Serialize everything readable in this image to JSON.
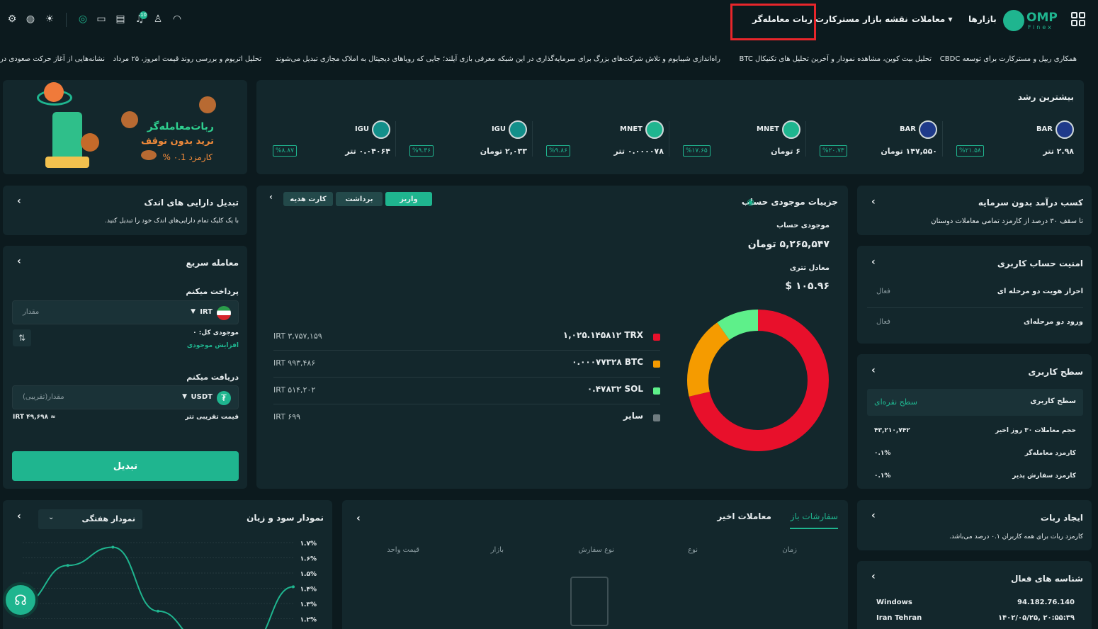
{
  "header": {
    "logo": "OMP",
    "logo_sub": "Finex",
    "nav": {
      "markets": "بازارها",
      "trades": "معاملات",
      "market_map": "نقشه بازار",
      "contract": "مسترکارت",
      "robot": "ربات معامله‌گر"
    },
    "notif_count": "10"
  },
  "ticker": [
    "همکاری ریپل و مسترکارت برای توسعه CBDC",
    "تحلیل بیت کوین، مشاهده نمودار و آخرین تحلیل های تکنیکال BTC",
    "راه‌اندازی شیبایوم و تلاش شرکت‌های بزرگ برای سرمایه‌گذاری در این شبکه",
    "معرفی بازی آیلند؛ جایی که رویاهای دیجیتال به املاک مجازی تبدیل می‌شوند",
    "تحلیل اتریوم و بررسی روند قیمت امروز، ۲۵ مرداد",
    "نشانه‌هایی از آغاز حرکت صعودی در ..."
  ],
  "banner": {
    "title": "ربات‌معامله‌گر",
    "subtitle": "ترید بدون توقف",
    "fee": "کارمزد ۰.1 %"
  },
  "top_growth": {
    "title": "بیشترین رشد",
    "items": [
      {
        "symbol": "BAR",
        "value": "۲.۹۸ تتر",
        "change": "%۲۱.۵۸",
        "color": "#1f3a8a"
      },
      {
        "symbol": "BAR",
        "value": "۱۴۷,۵۵۰ تومان",
        "change": "%۲۰.۷۳",
        "color": "#1f3a8a"
      },
      {
        "symbol": "MNET",
        "value": "۶ تومان",
        "change": "%۱۷.۶۵",
        "color": "#1fb58f"
      },
      {
        "symbol": "MNET",
        "value": "۰.۰۰۰۰۷۸ تتر",
        "change": "%۹.۸۶",
        "color": "#1fb58f"
      },
      {
        "symbol": "IGU",
        "value": "۲,۰۳۳ تومان",
        "change": "%۹.۳۶",
        "color": "#138f8a"
      },
      {
        "symbol": "IGU",
        "value": "۰.۰۴۰۶۴ تتر",
        "change": "%۸.۸۷",
        "color": "#138f8a"
      }
    ]
  },
  "passive_income": {
    "title": "کسب درآمد بدون سرمایه",
    "desc": "تا سقف ۳۰ درصد از کارمزد تمامی معاملات دوستان"
  },
  "security": {
    "title": "امنیت حساب کاربری",
    "rows": [
      {
        "label": "احراز هویت دو مرحله ای",
        "status": "فعال"
      },
      {
        "label": "ورود دو مرحله‌ای",
        "status": "فعال"
      }
    ]
  },
  "user_level": {
    "title": "سطح کاربری",
    "level_label": "سطح کاربری",
    "level_value": "سطح نقره‌ای",
    "rows": [
      {
        "label": "حجم معاملات ۳۰ روز اخیر",
        "value": "۴۳,۲۱۰,۷۴۲"
      },
      {
        "label": "کارمزد معامله‌گر",
        "value": "۰.۱%"
      },
      {
        "label": "کارمزد سفارش پذیر",
        "value": "۰.۱%"
      }
    ]
  },
  "create_robot": {
    "title": "ایجاد ربات",
    "desc": "کارمزد ربات برای همه کاربران ۰.۱ درصد می‌باشد."
  },
  "active_ids": {
    "title": "شناسه های فعال",
    "ip": "94.182.76.140",
    "os": "Windows",
    "time": "۲۰:۵۵:۳۹ ,۱۴۰۲/۰۵/۲۵",
    "location": "Iran Tehran"
  },
  "balance": {
    "title": "جزییات موجودی حساب",
    "tabs": {
      "deposit": "واریز",
      "withdraw": "برداشت",
      "gift": "کارت هدیه"
    },
    "balance_label": "موجودی حساب",
    "balance_value": "۵,۲۶۵,۵۴۷ تومان",
    "usdt_label": "معادل تتری",
    "usdt_value": "$ ۱۰۵.۹۶",
    "assets": [
      {
        "amount": "۱,۰۲۵.۱۴۵۸۱۲ TRX",
        "irt": "IRT ۳,۷۵۷,۱۵۹",
        "color": "#e8102b"
      },
      {
        "amount": "۰.۰۰۰۷۷۳۲۸ BTC",
        "irt": "IRT ۹۹۳,۴۸۶",
        "color": "#f59b00"
      },
      {
        "amount": "۰.۴۷۸۳۲ SOL",
        "irt": "IRT ۵۱۴,۲۰۲",
        "color": "#5ef08a"
      },
      {
        "amount": "سایر",
        "irt": "IRT ۶۹۹",
        "color": "#6f7c80"
      }
    ],
    "donut": [
      71.3,
      18.9,
      9.8,
      0.01
    ]
  },
  "small_assets": {
    "title": "تبدیل دارایی های اندک",
    "desc": "با یک کلیک تمام دارایی‌های اندک خود را تبدیل کنید."
  },
  "quick_trade": {
    "title": "معامله سریع",
    "pay_label": "پرداخت میکنم",
    "pay_currency": "IRT",
    "pay_placeholder": "مقدار",
    "balance_label": "موجودی کل:",
    "balance_value": "۰",
    "increase": "افزایش موجودی",
    "receive_label": "دریافت میکنم",
    "receive_currency": "USDT",
    "receive_placeholder": "مقدار(تقریبی)",
    "price_label": "قیمت تقریبی تتر",
    "price_value": "≈ ۴۹,۶۹۸ IRT",
    "convert": "تبدیل"
  },
  "orders": {
    "tab_open": "سفارشات باز",
    "tab_recent": "معاملات اخیر",
    "columns": [
      "زمان",
      "نوع",
      "نوع سفارش",
      "بازار",
      "قیمت واحد"
    ]
  },
  "pnl": {
    "title": "نمودار سود و زیان",
    "range": "نمودار هفتگی"
  },
  "chart_data": {
    "type": "line",
    "title": "نمودار سود و زیان",
    "y_ticks": [
      "۱.۷%",
      "۱.۶%",
      "۱.۵%",
      "۱.۴%",
      "۱.۳%",
      "۱.۲%"
    ],
    "ylim": [
      1.15,
      1.75
    ],
    "series": [
      {
        "x": [
          0,
          1,
          2,
          3,
          4,
          5,
          6
        ],
        "values": [
          1.3,
          1.55,
          1.67,
          1.25,
          1.05,
          1.02,
          1.41
        ]
      }
    ]
  },
  "colors": {
    "accent": "#1fb58f",
    "bg": "#0c1a1e",
    "card": "#13272c",
    "highlight": "#e8262b"
  }
}
